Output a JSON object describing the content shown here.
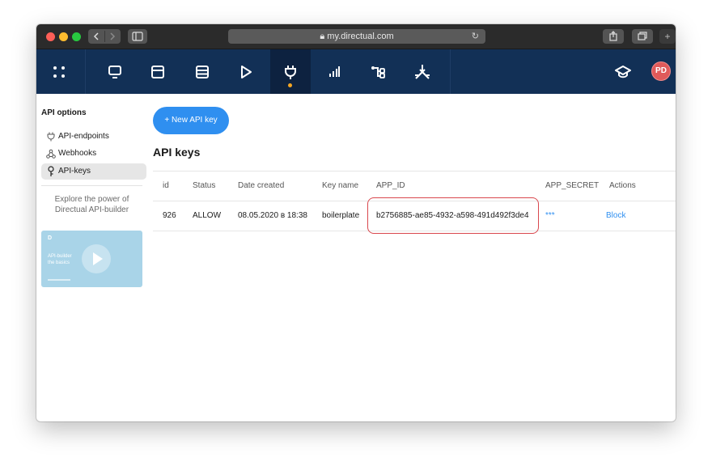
{
  "browser": {
    "url": "my.directual.com"
  },
  "appnav": {
    "avatar_initials": "PD",
    "icons": [
      "apps-grid-icon",
      "monitor-icon",
      "window-icon",
      "database-icon",
      "play-icon",
      "plug-icon",
      "bar-chart-icon",
      "flow-icon",
      "sync-icon",
      "graduation-cap-icon"
    ]
  },
  "sidebar": {
    "title": "API options",
    "items": [
      {
        "label": "API-endpoints",
        "icon": "plug-icon"
      },
      {
        "label": "Webhooks",
        "icon": "webhook-icon"
      },
      {
        "label": "API-keys",
        "icon": "key-icon",
        "active": true
      }
    ],
    "promo_line1": "Explore the power of",
    "promo_line2": "Directual API-builder",
    "promo_card": {
      "logo": "D",
      "line1": "API-builder",
      "line2": "the basics"
    }
  },
  "main": {
    "new_button_label": "+ New API key",
    "title": "API keys",
    "columns": [
      "id",
      "Status",
      "Date created",
      "Key name",
      "APP_ID",
      "APP_SECRET",
      "Actions"
    ],
    "rows": [
      {
        "id": "926",
        "status": "ALLOW",
        "date_created": "08.05.2020 в 18:38",
        "key_name": "boilerplate",
        "app_id": "b2756885-ae85-4932-a598-491d492f3de4",
        "app_secret": "***",
        "action": "Block"
      }
    ]
  },
  "colors": {
    "appbar": "#123056",
    "accent": "#2f8ff0",
    "active_dot": "#f5a623",
    "highlight": "#d9474d"
  }
}
